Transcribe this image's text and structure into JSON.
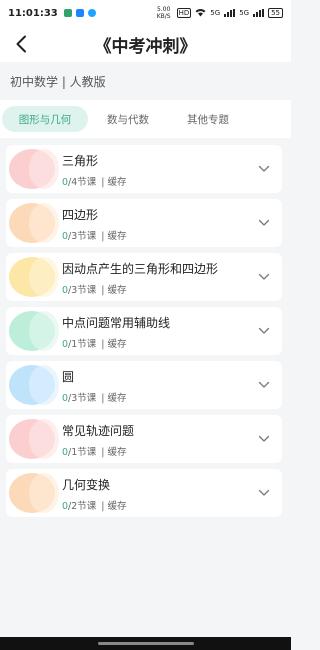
{
  "status_bar": {
    "time": "11:01:33",
    "speed": "5.00 KB/S",
    "network": "HD",
    "signal_1": "5G",
    "signal_2": "5G",
    "battery": "55"
  },
  "header": {
    "title": "《中考冲刺》"
  },
  "subject": {
    "label": "初中数学 | 人教版"
  },
  "tabs": [
    {
      "label": "图形与几何",
      "active": true
    },
    {
      "label": "数与代数",
      "active": false
    },
    {
      "label": "其他专题",
      "active": false
    }
  ],
  "courses": [
    {
      "title": "三角形",
      "done": "0",
      "total": "/4节课",
      "cache": "| 缓存",
      "color": "#fbcfd0"
    },
    {
      "title": "四边形",
      "done": "0",
      "total": "/3节课",
      "cache": "| 缓存",
      "color": "#fcd9b8"
    },
    {
      "title": "因动点产生的三角形和四边形",
      "done": "0",
      "total": "/3节课",
      "cache": "| 缓存",
      "color": "#fce7a6"
    },
    {
      "title": "中点问题常用辅助线",
      "done": "0",
      "total": "/1节课",
      "cache": "| 缓存",
      "color": "#bdeed9"
    },
    {
      "title": "圆",
      "done": "0",
      "total": "/3节课",
      "cache": "| 缓存",
      "color": "#bfe3fb"
    },
    {
      "title": "常见轨迹问题",
      "done": "0",
      "total": "/1节课",
      "cache": "| 缓存",
      "color": "#fbcfd0"
    },
    {
      "title": "几何变换",
      "done": "0",
      "total": "/2节课",
      "cache": "| 缓存",
      "color": "#fcd9b8"
    }
  ],
  "colors": {
    "accent": "#3aa78b",
    "tab_active_bg": "#dff3ee"
  },
  "icons": {
    "back": "back-arrow-icon",
    "expand": "chevron-down-icon"
  }
}
